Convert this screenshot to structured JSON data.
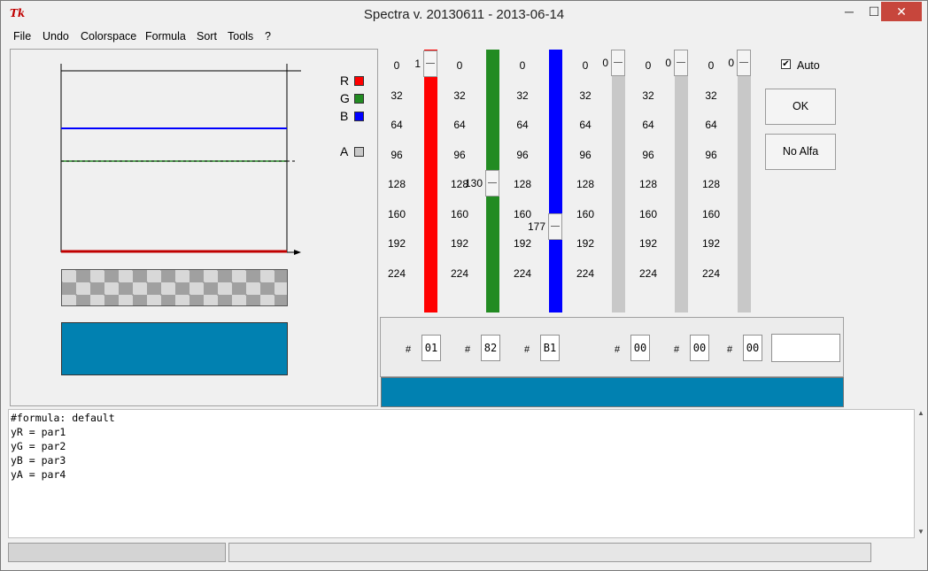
{
  "window": {
    "title": "Spectra v. 20130611 - 2013-06-14",
    "icon_text": "Tk",
    "minimize_glyph": "─",
    "maximize_glyph": "☐",
    "close_glyph": "✕"
  },
  "menu": [
    "File",
    "Undo",
    "Colorspace",
    "Formula",
    "Sort",
    "Tools",
    "?"
  ],
  "legend": [
    {
      "label": "R",
      "color": "#ff0000"
    },
    {
      "label": "G",
      "color": "#228b22"
    },
    {
      "label": "B",
      "color": "#0000ff"
    },
    {
      "label": "A",
      "color": "#c8c8c8"
    }
  ],
  "scale_ticks": [
    "0",
    "32",
    "64",
    "96",
    "128",
    "160",
    "192",
    "224"
  ],
  "sliders": [
    {
      "name": "red",
      "value": "1",
      "color": "#ff0000"
    },
    {
      "name": "green",
      "value": "130",
      "color": "#228b22"
    },
    {
      "name": "blue",
      "value": "177",
      "color": "#0000ff"
    },
    {
      "name": "par4",
      "value": "0",
      "color": "#c8c8c8"
    },
    {
      "name": "par5",
      "value": "0",
      "color": "#c8c8c8"
    },
    {
      "name": "par6",
      "value": "0",
      "color": "#c8c8c8"
    }
  ],
  "auto": {
    "label": "Auto",
    "checked": true,
    "check_glyph": "✔"
  },
  "buttons": {
    "ok": "OK",
    "no_alfa": "No Alfa"
  },
  "hex": {
    "hash": "#",
    "values": [
      "01",
      "82",
      "B1",
      "00",
      "00",
      "00"
    ]
  },
  "preview_color": "#0181b1",
  "formula": [
    "#formula: default",
    "yR = par1",
    "yG = par2",
    "yB = par3",
    "yA = par4"
  ],
  "scroll": {
    "up": "▲",
    "down": "▼"
  }
}
